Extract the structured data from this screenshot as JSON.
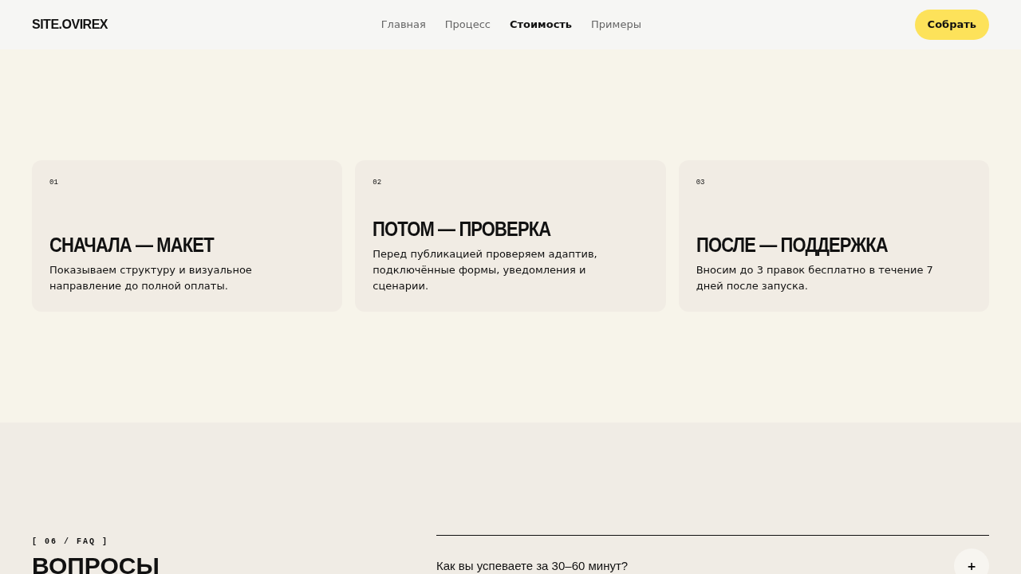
{
  "header": {
    "logo": "SITE.OVIREX",
    "nav": [
      {
        "label": "Главная",
        "selected": false
      },
      {
        "label": "Процесс",
        "selected": false
      },
      {
        "label": "Стоимость",
        "selected": true
      },
      {
        "label": "Примеры",
        "selected": false
      }
    ],
    "cta": "Собрать"
  },
  "steps": [
    {
      "number": "01",
      "title": "СНАЧАЛА — МАКЕТ",
      "text": "Показываем структуру и визуальное направление до полной оплаты."
    },
    {
      "number": "02",
      "title": "ПОТОМ — ПРОВЕРКА",
      "text": "Перед публикацией проверяем адаптив, подключённые формы, уведомления и сценарии."
    },
    {
      "number": "03",
      "title": "ПОСЛЕ — ПОДДЕРЖКА",
      "text": "Вносим до 3 правок бесплатно в течение 7 дней после запуска."
    }
  ],
  "faq": {
    "label": "[ 06 / FAQ ]",
    "title": "ВОПРОСЫ",
    "items": [
      {
        "question": "Как вы успеваете за 30–60 минут?",
        "toggle": "+"
      }
    ]
  }
}
